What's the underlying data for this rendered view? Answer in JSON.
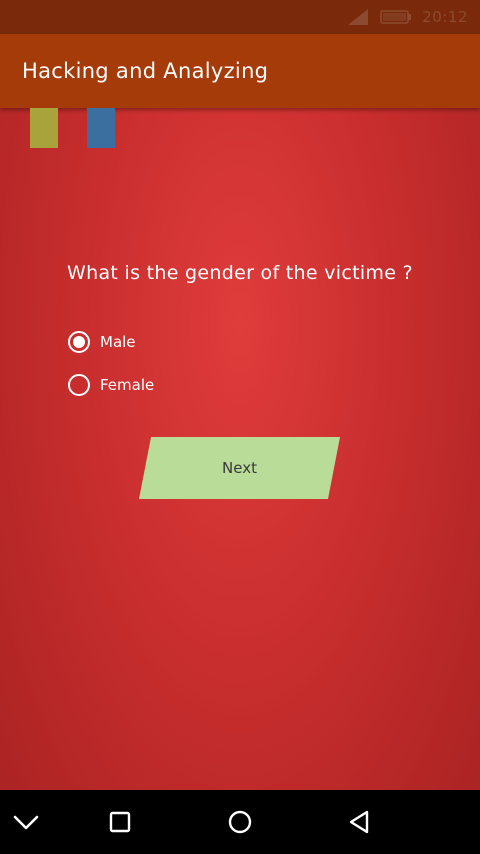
{
  "status_bar": {
    "time": "20:12",
    "signal_icon": "signal-icon",
    "battery_icon": "battery-icon"
  },
  "app_bar": {
    "title": "Hacking and Analyzing",
    "color": "#a63b0a"
  },
  "swatches": [
    {
      "name": "yellow",
      "color": "#a8a33a"
    },
    {
      "name": "blue",
      "color": "#3a6fa0"
    }
  ],
  "quiz": {
    "question": "What is the gender of the victime ?",
    "options": [
      {
        "label": "Male",
        "selected": true
      },
      {
        "label": "Female",
        "selected": false
      }
    ],
    "next_label": "Next",
    "next_color": "#b9dc99"
  },
  "nav_bar": {
    "icons": [
      "chevron-down-icon",
      "recents-icon",
      "home-icon",
      "back-icon"
    ]
  },
  "colors": {
    "background": "#d33535",
    "status_bar": "#7a2a0a"
  }
}
